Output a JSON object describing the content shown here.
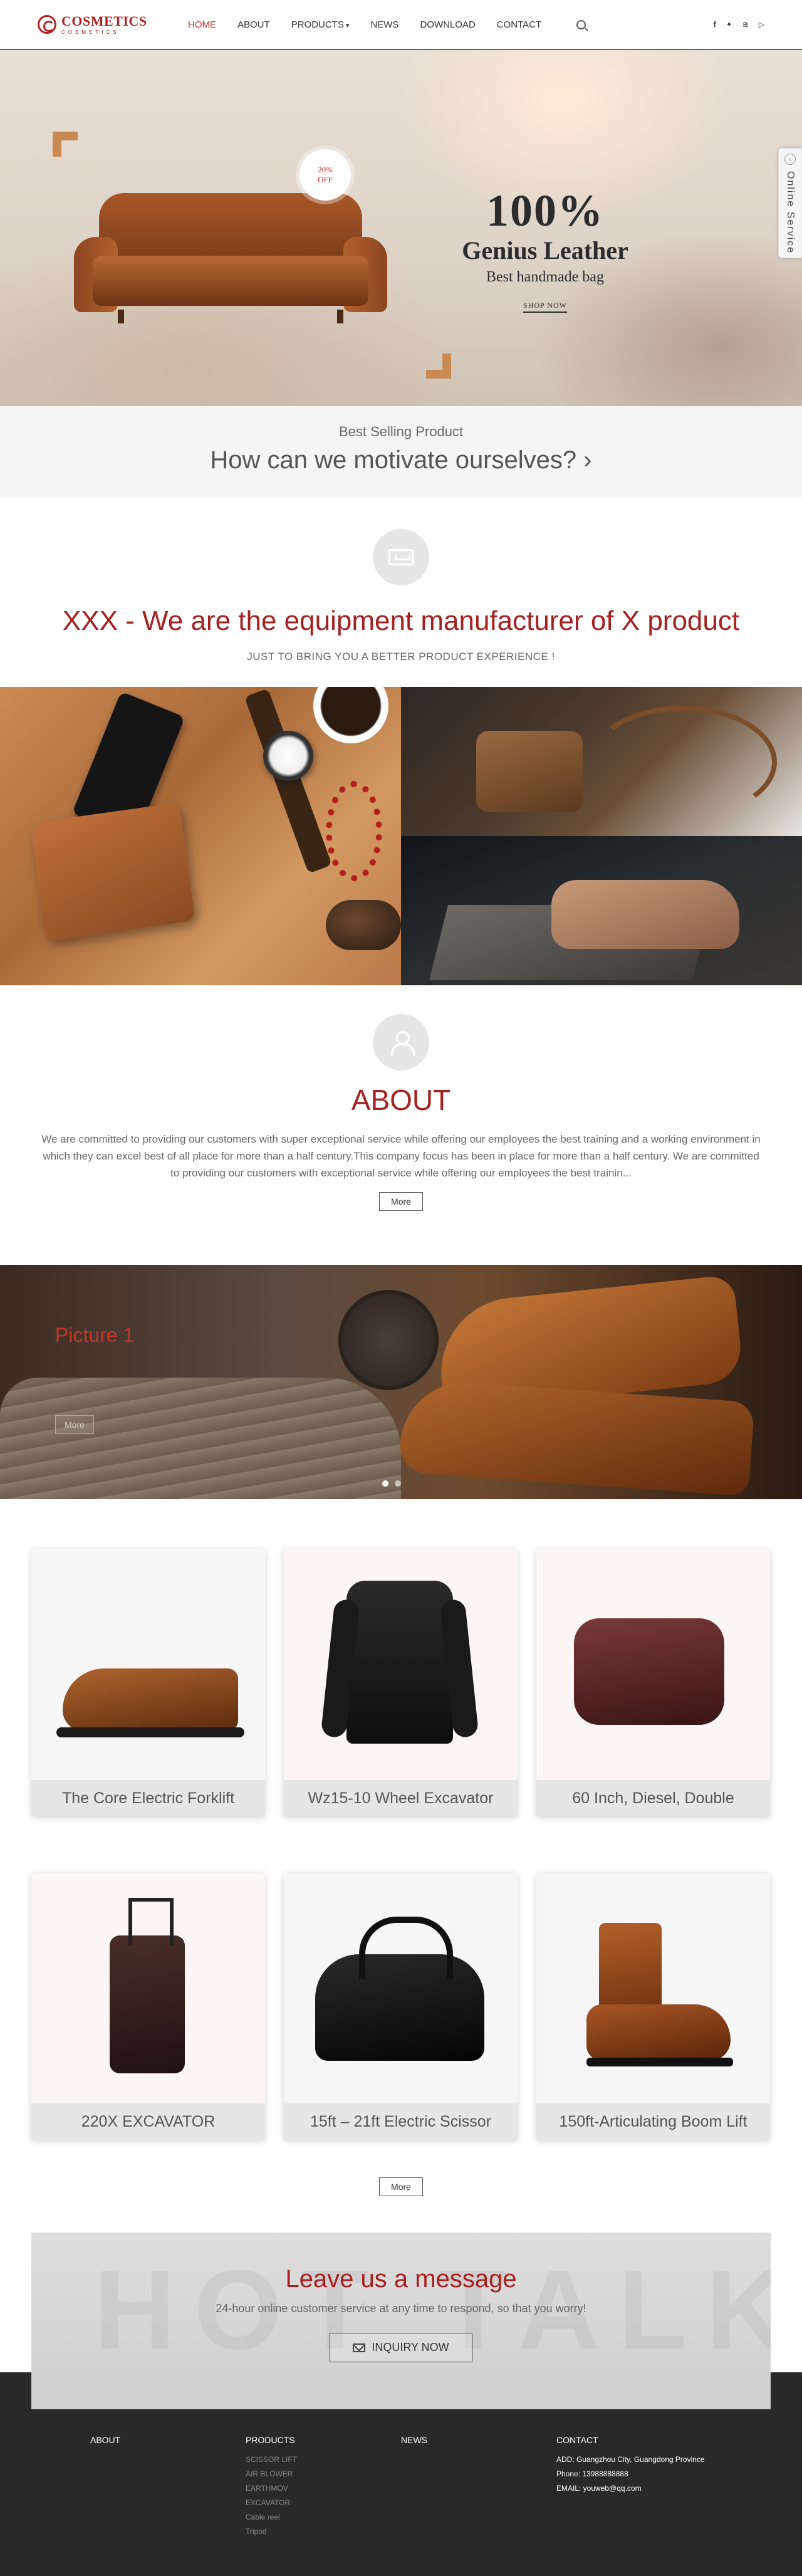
{
  "header": {
    "logo_main": "COSMETICS",
    "logo_sub": "COSMETICS",
    "nav": [
      {
        "label": "HOME",
        "active": true
      },
      {
        "label": "ABOUT"
      },
      {
        "label": "PRODUCTS",
        "dropdown": true
      },
      {
        "label": "NEWS"
      },
      {
        "label": "DOWNLOAD"
      },
      {
        "label": "CONTACT"
      }
    ],
    "social": [
      "f",
      "t",
      "rss",
      "yt"
    ]
  },
  "hero": {
    "discount_line1": "20%",
    "discount_line2": "OFF",
    "big": "100%",
    "mid": "Genius Leather",
    "small": "Best handmade bag",
    "link": "SHOP NOW",
    "slides": 2,
    "active_slide": 1
  },
  "online_service": "Online Service",
  "motivate": {
    "sub": "Best Selling Product",
    "main": "How can we motivate ourselves?"
  },
  "manufacturer": {
    "title": "XXX - We are the equipment manufacturer of X product",
    "subtitle": "JUST TO BRING YOU A BETTER PRODUCT EXPERIENCE !"
  },
  "about": {
    "title": "ABOUT",
    "text": "We are committed to providing our customers with super exceptional service while offering our employees the best training and a working environment in which they can excel best of all place for more than a half century.This company focus has been in place for more than a half century. We are committed to providing our customers with exceptional service while offering our employees the best trainin...",
    "more": "More"
  },
  "picture_banner": {
    "title": "Picture 1",
    "button": "More"
  },
  "products": {
    "items": [
      {
        "name": "The Core Electric Forklift"
      },
      {
        "name": "Wz15-10 Wheel Excavator"
      },
      {
        "name": "60 Inch, Diesel, Double"
      },
      {
        "name": "220X EXCAVATOR"
      },
      {
        "name": "15ft – 21ft Electric Scissor"
      },
      {
        "name": "150ft-Articulating Boom Lift"
      }
    ],
    "more": "More"
  },
  "message": {
    "ghost": "HOT TALK",
    "title": "Leave us a message",
    "subtitle": "24-hour online customer service at any time to respond, so that you worry!",
    "button": "INQUIRY NOW"
  },
  "footer": {
    "about_title": "ABOUT",
    "products_title": "PRODUCTS",
    "products_items": [
      "SCISSOR LIFT",
      "AIR BLOWER",
      "EARTHMOV",
      "EXCAVATOR",
      "Cable reel",
      "Tripod"
    ],
    "news_title": "NEWS",
    "contact_title": "CONTACT",
    "contact_items": [
      "ADD: Guangzhou City, Guangdong Province",
      "Phone: 13988888888",
      "EMAIL: youweb@qq.com"
    ]
  },
  "colors": {
    "accent": "#c0392b",
    "heading_red": "#a62020",
    "footer_bg": "#292929"
  }
}
